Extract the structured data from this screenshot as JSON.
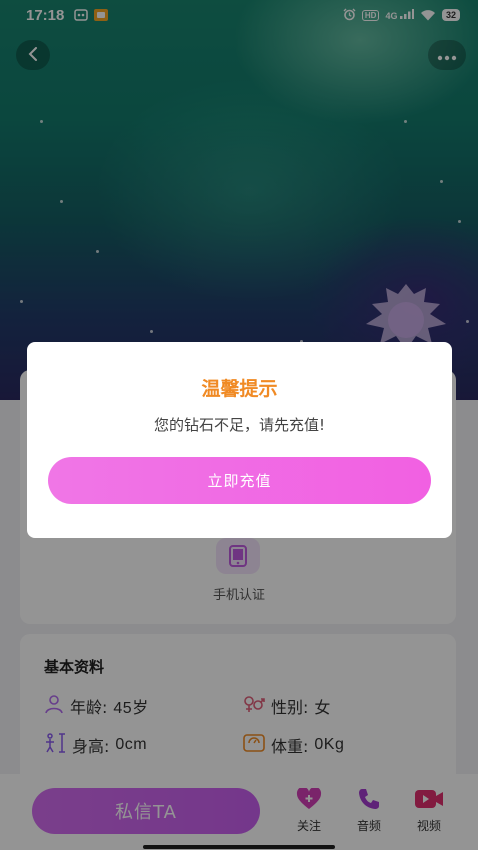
{
  "status_bar": {
    "time": "17:18",
    "hd_label": "HD",
    "network_label": "4G",
    "battery_level": "32"
  },
  "verification": {
    "phone_label": "手机认证"
  },
  "basic_info": {
    "title": "基本资料",
    "items": [
      {
        "label": "年龄:",
        "value": "45岁",
        "icon": "person-icon"
      },
      {
        "label": "性别:",
        "value": "女",
        "icon": "gender-icon"
      },
      {
        "label": "身高:",
        "value": "0cm",
        "icon": "height-icon"
      },
      {
        "label": "体重:",
        "value": "0Kg",
        "icon": "weight-icon"
      }
    ]
  },
  "bottom_bar": {
    "message_button": "私信TA",
    "actions": [
      {
        "label": "关注",
        "icon": "heart-plus-icon"
      },
      {
        "label": "音频",
        "icon": "phone-icon"
      },
      {
        "label": "视频",
        "icon": "video-icon"
      }
    ]
  },
  "dialog": {
    "title": "温馨提示",
    "message": "您的钻石不足，请先充值!",
    "button": "立即充值"
  },
  "colors": {
    "accent_orange": "#f08a24",
    "accent_pink": "#f16fe4",
    "accent_purple": "#c95ff0"
  }
}
